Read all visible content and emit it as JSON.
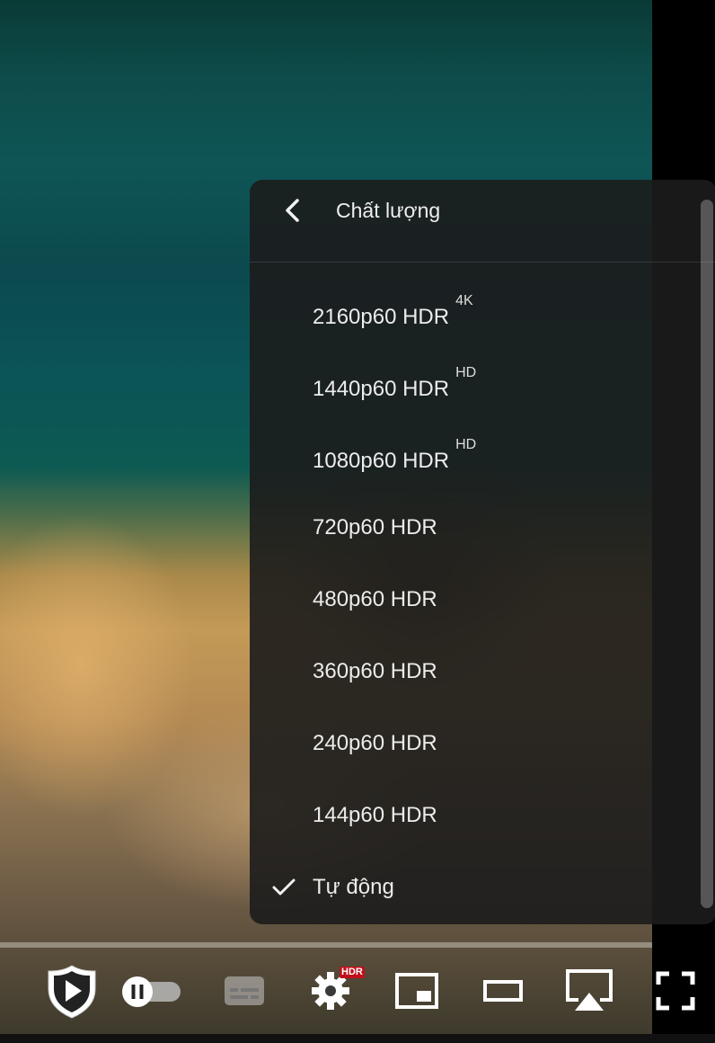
{
  "quality_menu": {
    "title": "Chất lượng",
    "items": [
      {
        "label": "2160p60 HDR",
        "badge": "4K",
        "selected": false
      },
      {
        "label": "1440p60 HDR",
        "badge": "HD",
        "selected": false
      },
      {
        "label": "1080p60 HDR",
        "badge": "HD",
        "selected": false
      },
      {
        "label": "720p60 HDR",
        "badge": "",
        "selected": false
      },
      {
        "label": "480p60 HDR",
        "badge": "",
        "selected": false
      },
      {
        "label": "360p60 HDR",
        "badge": "",
        "selected": false
      },
      {
        "label": "240p60 HDR",
        "badge": "",
        "selected": false
      },
      {
        "label": "144p60 HDR",
        "badge": "",
        "selected": false
      },
      {
        "label": "Tự động",
        "badge": "",
        "selected": true
      }
    ]
  },
  "player_controls": {
    "settings_badge": "HDR",
    "icons": [
      "play-shield-icon",
      "autoplay-toggle-icon",
      "subtitles-icon",
      "settings-gear-icon",
      "miniplayer-icon",
      "theater-mode-icon",
      "airplay-icon",
      "fullscreen-icon"
    ]
  },
  "colors": {
    "menu_bg": "#1c1c1c",
    "menu_text": "#ececec",
    "hdr_badge": "#c0101c"
  }
}
